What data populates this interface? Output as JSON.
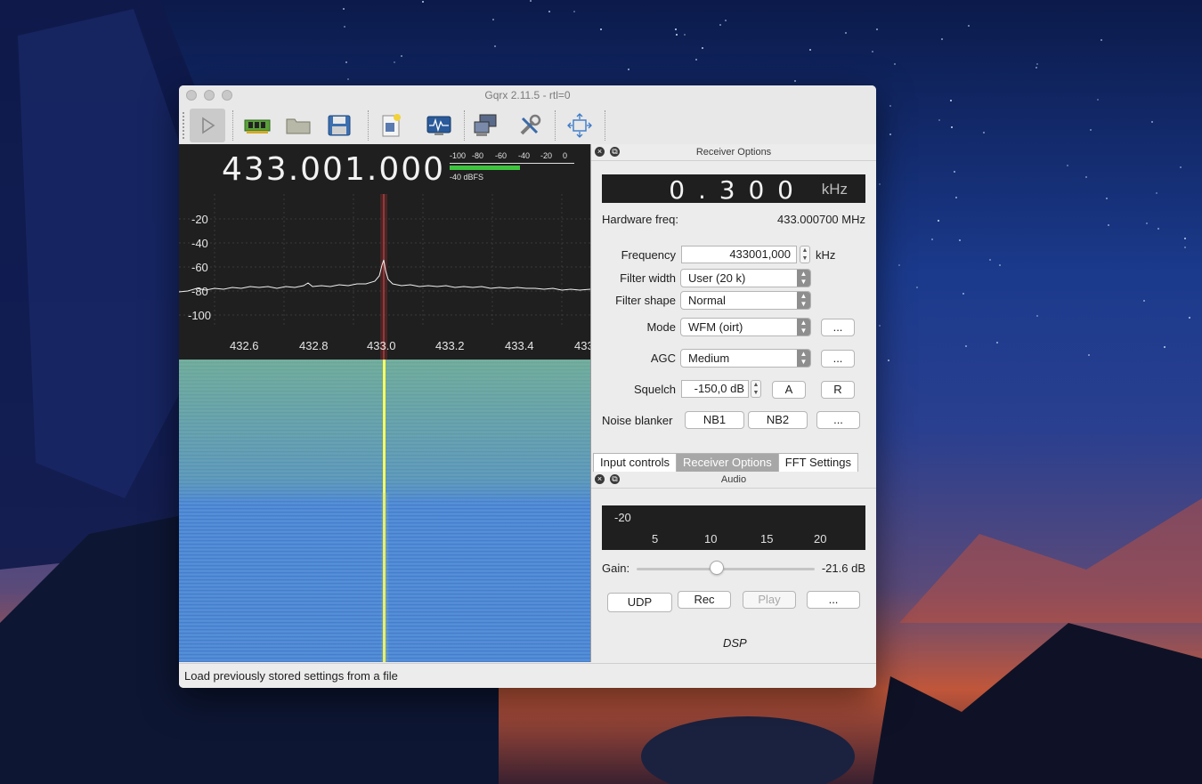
{
  "window": {
    "title": "Gqrx 2.11.5 - rtl=0"
  },
  "toolbar": {
    "items": [
      "play-icon",
      "hardware-chip-icon",
      "folder-icon",
      "floppy-save-icon",
      "bookmark-document-icon",
      "waveform-monitor-icon",
      "network-computer-icon",
      "tools-icon",
      "fullscreen-arrows-icon"
    ]
  },
  "plot": {
    "frequency_readout": "433.001.000",
    "meter": {
      "scale": [
        "-100",
        "-80",
        "-60",
        "-40",
        "-20",
        "0"
      ],
      "label": "-40 dBFS",
      "level_dbfs": -40
    },
    "fft_y_ticks": [
      "-20",
      "-40",
      "-60",
      "-80",
      "-100"
    ],
    "fft_x_ticks": [
      "432.6",
      "432.8",
      "433.0",
      "433.2",
      "433.4",
      "433"
    ]
  },
  "receiver_options": {
    "dock_title": "Receiver Options",
    "offset_value": "0 . 3 0 0",
    "offset_unit": "kHz",
    "hardware_freq_label": "Hardware freq:",
    "hardware_freq_value": "433.000700 MHz",
    "frequency_label": "Frequency",
    "frequency_value": "433001,000",
    "frequency_unit": "kHz",
    "filter_width_label": "Filter width",
    "filter_width_value": "User (20 k)",
    "filter_shape_label": "Filter shape",
    "filter_shape_value": "Normal",
    "mode_label": "Mode",
    "mode_value": "WFM (oirt)",
    "agc_label": "AGC",
    "agc_value": "Medium",
    "squelch_label": "Squelch",
    "squelch_value": "-150,0 dB",
    "squelch_auto": "A",
    "squelch_reset": "R",
    "noise_blanker_label": "Noise blanker",
    "nb1": "NB1",
    "nb2": "NB2",
    "more": "..."
  },
  "tabs": [
    "Input controls",
    "Receiver Options",
    "FFT Settings"
  ],
  "audio": {
    "dock_title": "Audio",
    "scale_top": "-20",
    "scale_ticks": [
      "5",
      "10",
      "15",
      "20"
    ],
    "gain_label": "Gain:",
    "gain_value": "-21.6 dB",
    "udp": "UDP",
    "rec": "Rec",
    "play": "Play",
    "more": "...",
    "dsp_label": "DSP"
  },
  "status_bar": {
    "text": "Load previously stored settings from a file"
  }
}
